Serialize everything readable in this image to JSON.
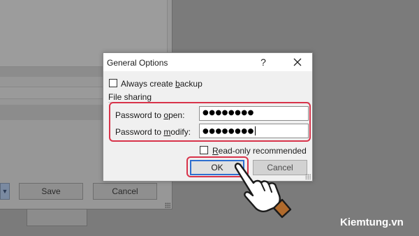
{
  "background_window": {
    "buttons": {
      "save_label": "Save",
      "cancel_label": "Cancel"
    },
    "dropdown_arrow": "▼"
  },
  "dialog": {
    "title": "General Options",
    "help_label": "?",
    "always_create_backup": {
      "label_pre": "Always create ",
      "label_accel": "b",
      "label_post": "ackup",
      "checked": false
    },
    "file_sharing_label": "File sharing",
    "password_open": {
      "label_pre": "Password to ",
      "label_accel": "o",
      "label_post": "pen:",
      "value": "●●●●●●●●"
    },
    "password_modify": {
      "label_pre": "Password to ",
      "label_accel": "m",
      "label_post": "odify:",
      "value": "●●●●●●●●"
    },
    "read_only_recommended": {
      "label_accel": "R",
      "label_post": "ead-only recommended",
      "checked": false
    },
    "ok_label": "OK",
    "cancel_label": "Cancel"
  },
  "watermark": "Kiemtung.vn",
  "colors": {
    "highlight": "#d8334a",
    "ok_focus_border": "#2f6fcf",
    "dialog_background": "#f0f0f0",
    "overlay_background": "#7b7b7b"
  }
}
